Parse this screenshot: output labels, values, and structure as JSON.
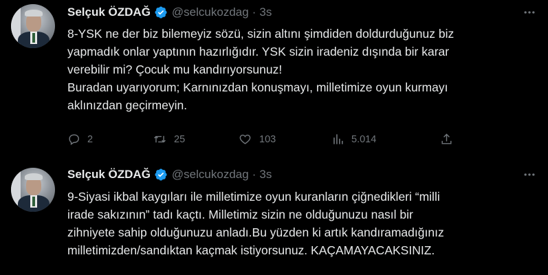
{
  "colors": {
    "background": "#000000",
    "text": "#e7e9ea",
    "muted": "#71767b",
    "verified": "#1d9bf0"
  },
  "tweets": [
    {
      "author_name": "Selçuk ÖZDAĞ",
      "handle": "@selcukozdag",
      "separator": "·",
      "time": "3s",
      "text": "8-YSK ne der biz bilemeyiz sözü, sizin altını şimdiden doldurduğunuz biz\nyapmadık onlar yaptının hazırlığıdır. YSK sizin iradeniz dışında bir karar\nverebilir mi? Çocuk mu kandırıyorsunuz!\nBuradan uyarıyorum; Karnınızdan konuşmayı, milletimize oyun kurmayı\naklınızdan geçirmeyin.",
      "replies": "2",
      "retweets": "25",
      "likes": "103",
      "views": "5.014",
      "icons": [
        "reply-icon",
        "retweet-icon",
        "like-icon",
        "views-icon",
        "share-icon"
      ]
    },
    {
      "author_name": "Selçuk ÖZDAĞ",
      "handle": "@selcukozdag",
      "separator": "·",
      "time": "3s",
      "text": "9-Siyasi ikbal kaygıları ile milletimize oyun kuranların  çiğnedikleri “milli\nirade sakızının” tadı kaçtı. Milletimiz sizin ne olduğunuzu nasıl bir\nzihniyete sahip olduğunuzu anladı.Bu yüzden ki artık kandıramadığınız\nmilletimizden/sandıktan kaçmak istiyorsunuz. KAÇAMAYACAKSINIZ."
    }
  ]
}
